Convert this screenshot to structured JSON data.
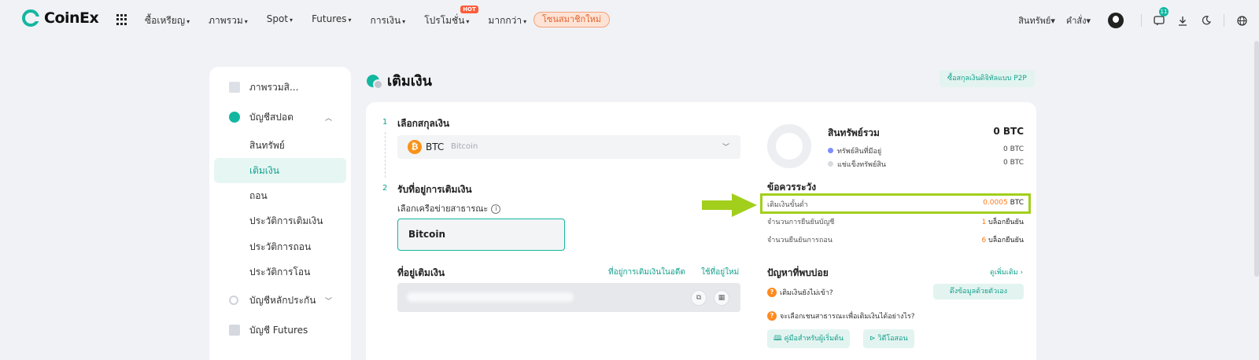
{
  "header": {
    "logo_text": "CoinEx",
    "nav": [
      {
        "label": "ซื้อเหรียญ",
        "caret": "▾"
      },
      {
        "label": "ภาพรวม",
        "caret": "▾"
      },
      {
        "label": "Spot",
        "caret": "▾"
      },
      {
        "label": "Futures",
        "caret": "▾"
      },
      {
        "label": "การเงิน",
        "caret": "▾"
      },
      {
        "label": "โปรโมชั่น",
        "caret": "▾",
        "badge": "HOT"
      },
      {
        "label": "มากกว่า",
        "caret": "▾"
      }
    ],
    "promo_pill": "โซนสมาชิกใหม่",
    "right": {
      "assets": "สินทรัพย์",
      "orders": "คำสั่ง",
      "notification_count": "11",
      "accent_color": "#13b7a0"
    }
  },
  "sidebar": {
    "items": [
      {
        "label": "ภาพรวมสิ...",
        "icon": "overview-icon"
      },
      {
        "label": "บัญชีสปอต",
        "icon": "spot-account-icon",
        "chevron": "︿"
      },
      {
        "label": "สินทรัพย์"
      },
      {
        "label": "เติมเงิน",
        "active": true
      },
      {
        "label": "ถอน"
      },
      {
        "label": "ประวัติการเติมเงิน"
      },
      {
        "label": "ประวัติการถอน"
      },
      {
        "label": "ประวัติการโอน"
      },
      {
        "label": "บัญชีหลักประกัน",
        "icon": "margin-account-icon",
        "chevron": "﹀"
      },
      {
        "label": "บัญชี Futures",
        "icon": "futures-account-icon"
      }
    ]
  },
  "main": {
    "title": "เติมเงิน",
    "p2p_button": "ซื้อสกุลเงินดิจิทัลแบบ P2P",
    "step1": {
      "num": "1",
      "label": "เลือกสกุลเงิน"
    },
    "coin": {
      "symbol": "BTC",
      "name": "Bitcoin",
      "icon_glyph": "₿"
    },
    "step2": {
      "num": "2",
      "label": "รับที่อยู่การเติมเงิน"
    },
    "network_label": "เลือกเครือข่ายสาธารณะ",
    "network_value": "Bitcoin",
    "address_label": "ที่อยู่เติมเงิน",
    "address_history_link": "ที่อยู่การเติมเงินในอดีต",
    "new_address_link": "ใช้ที่อยู่ใหม่"
  },
  "assets": {
    "title": "สินทรัพย์รวม",
    "total": "0 BTC",
    "legend": [
      {
        "label": "ทรัพย์สินที่มีอยู่",
        "value": "0 BTC",
        "color": "#7f8cff"
      },
      {
        "label": "แช่แข็งทรัพย์สิน",
        "value": "0 BTC",
        "color": "#d8dbe0"
      }
    ]
  },
  "notice": {
    "title": "ข้อควรระวัง",
    "rows": [
      {
        "label": "เติมเงินขั้นต่ำ",
        "value_highlight": "0.0005",
        "value_unit": " BTC"
      },
      {
        "label": "จำนวนการยืนยันบัญชี",
        "value_highlight": "1",
        "value_unit": " บล็อกยืนยัน"
      },
      {
        "label": "จำนวนยืนยันการถอน",
        "value_highlight": "6",
        "value_unit": " บล็อกยืนยัน"
      }
    ],
    "highlight_color": "#a2cf1c"
  },
  "faq": {
    "title": "ปัญหาที่พบบ่อย",
    "more": "ดูเพิ่มเติม ›",
    "q1": "เติมเงินยังไม่เข้า?",
    "q2": "จะเลือกเชนสาธารณะเพื่อเติมเงินได้อย่างไร?",
    "self_button": "ดึงข้อมูลด้วยตัวเอง",
    "beginner_guide": "คู่มือสำหรับผู้เริ่มต้น",
    "video_tutorial": "วิดีโอสอน"
  }
}
